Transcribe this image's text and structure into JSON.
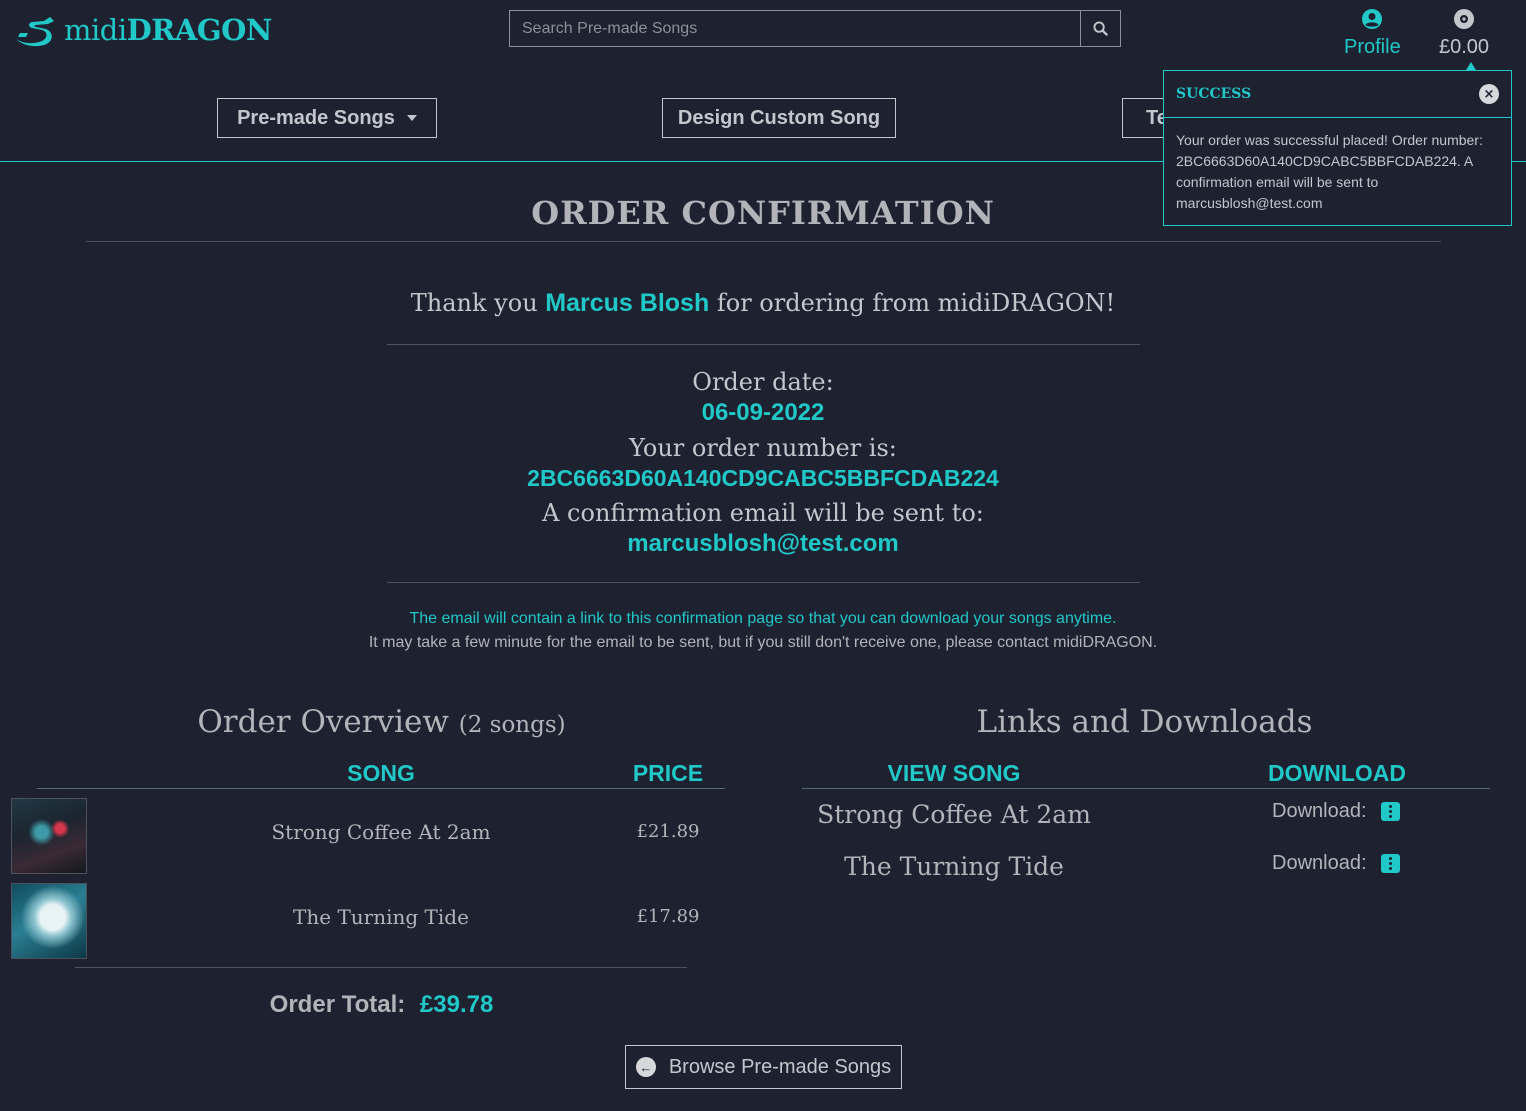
{
  "header": {
    "logo_light": "midi",
    "logo_bold": "DRAGON",
    "search_placeholder": "Search Pre-made Songs",
    "profile_label": "Profile",
    "basket_amount": "£0.00"
  },
  "nav": {
    "premade_label": "Pre-made Songs",
    "design_label": "Design Custom Song",
    "third_label_partial": "Te"
  },
  "toast": {
    "title": "SUCCESS",
    "message": "Your order was successful placed! Order number: 2BC6663D60A140CD9CABC5BBFCDAB224. A confirmation email will be sent to marcusblosh@test.com"
  },
  "confirmation": {
    "title": "ORDER CONFIRMATION",
    "thanks_prefix": "Thank you",
    "customer_name": "Marcus Blosh",
    "thanks_suffix": "for ordering from midiDRAGON!",
    "order_date_label": "Order date:",
    "order_date": "06-09-2022",
    "order_number_label": "Your order number is:",
    "order_number": "2BC6663D60A140CD9CABC5BBFCDAB224",
    "email_label": "A confirmation email will be sent to:",
    "email": "marcusblosh@test.com",
    "note_line1": "The email will contain a link to this confirmation page so that you can download your songs anytime.",
    "note_line2": "It may take a few minute for the email to be sent, but if you still don't receive one, please contact midiDRAGON."
  },
  "overview": {
    "heading": "Order Overview",
    "count": "(2 songs)",
    "col_song": "SONG",
    "col_price": "PRICE",
    "items": [
      {
        "name": "Strong Coffee At 2am",
        "price": "£21.89"
      },
      {
        "name": "The Turning Tide",
        "price": "£17.89"
      }
    ],
    "total_label": "Order Total:",
    "total_value": "£39.78"
  },
  "links": {
    "heading": "Links and Downloads",
    "col_view": "VIEW SONG",
    "col_download": "DOWNLOAD",
    "items": [
      {
        "name": "Strong Coffee At 2am",
        "download_label": "Download:"
      },
      {
        "name": "The Turning Tide",
        "download_label": "Download:"
      }
    ]
  },
  "browse_label": "Browse Pre-made Songs"
}
